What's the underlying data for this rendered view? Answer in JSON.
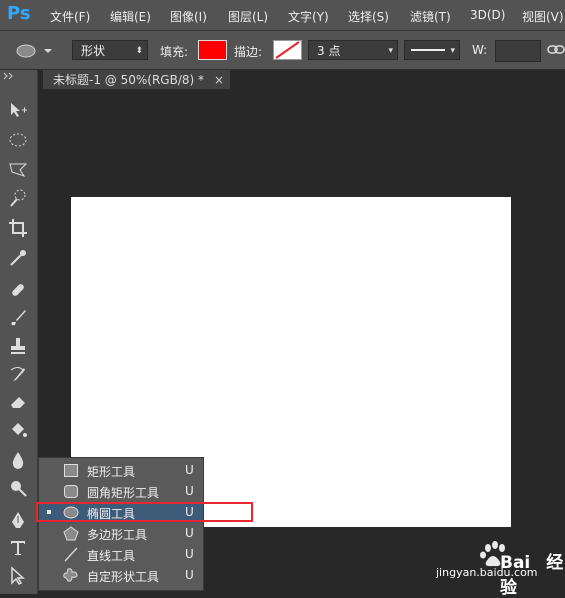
{
  "app": {
    "logo": "Ps"
  },
  "menu": [
    "文件(F)",
    "编辑(E)",
    "图像(I)",
    "图层(L)",
    "文字(Y)",
    "选择(S)",
    "滤镜(T)",
    "3D(D)",
    "视图(V)"
  ],
  "options": {
    "mode_value": "形状",
    "fill_label": "填充:",
    "fill_color": "#ff0000",
    "stroke_label": "描边:",
    "stroke_width_value": "3 点",
    "w_label": "W:"
  },
  "document": {
    "tab_title": "未标题-1 @ 50%(RGB/8) *",
    "close_glyph": "×"
  },
  "tool_flyout": {
    "items": [
      {
        "label": "矩形工具",
        "shortcut": "U",
        "icon": "rectangle-icon"
      },
      {
        "label": "圆角矩形工具",
        "shortcut": "U",
        "icon": "rounded-rectangle-icon"
      },
      {
        "label": "椭圆工具",
        "shortcut": "U",
        "icon": "ellipse-icon",
        "current": true
      },
      {
        "label": "多边形工具",
        "shortcut": "U",
        "icon": "polygon-icon"
      },
      {
        "label": "直线工具",
        "shortcut": "U",
        "icon": "line-icon"
      },
      {
        "label": "自定形状工具",
        "shortcut": "U",
        "icon": "custom-shape-icon"
      }
    ]
  },
  "watermark": {
    "brand": "Bai",
    "brand2": "经验",
    "url": "jingyan.baidu.com"
  },
  "colors": {
    "accent_highlight": "#e8262e",
    "ps_blue": "#31a8ff"
  }
}
